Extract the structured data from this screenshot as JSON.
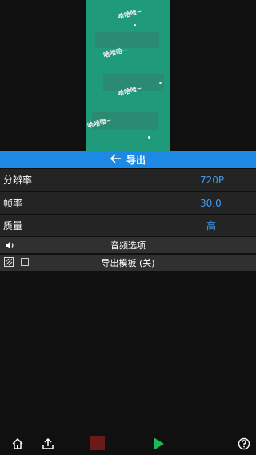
{
  "preview": {
    "overlay_texts": [
      "哈哈哈~",
      "哈哈哈~",
      "哈哈哈~",
      "哈哈哈~"
    ]
  },
  "header": {
    "title": "导出",
    "back_icon": "arrow-left-icon"
  },
  "settings": [
    {
      "label": "分辨率",
      "value": "720P"
    },
    {
      "label": "帧率",
      "value": "30.0"
    },
    {
      "label": "质量",
      "value": "高"
    }
  ],
  "audio_bar": {
    "label": "音频选项",
    "icon": "speaker-icon"
  },
  "template_bar": {
    "label": "导出模板 (关)",
    "icon": "template-grid-icon",
    "checked": false
  },
  "toolbar": {
    "home_icon": "home-icon",
    "share_icon": "upload-icon",
    "stop_icon": "stop-icon",
    "play_icon": "play-icon",
    "help_icon": "help-icon"
  },
  "colors": {
    "accent": "#1e88e5",
    "value_text": "#3f9bf0",
    "play": "#1db954",
    "stop": "#6b1a1a",
    "preview_green": "#1f9a7a"
  }
}
